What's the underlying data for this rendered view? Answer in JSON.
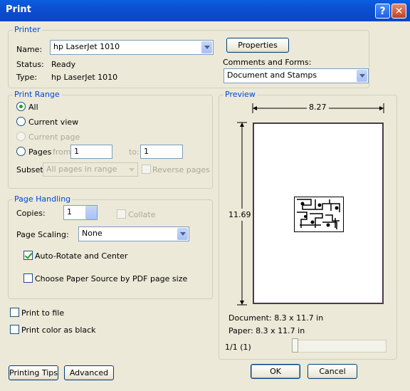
{
  "window": {
    "title": "Print",
    "help_label": "?",
    "close_label": "✕"
  },
  "printer": {
    "legend": "Printer",
    "name_label": "Name:",
    "name_value": "hp LaserJet 1010",
    "status_label": "Status:",
    "status_value": "Ready",
    "type_label": "Type:",
    "type_value": "hp LaserJet 1010",
    "properties_button": "Properties",
    "comments_label": "Comments and Forms:",
    "comments_value": "Document and Stamps"
  },
  "print_range": {
    "legend": "Print Range",
    "all": "All",
    "current_view": "Current view",
    "current_page": "Current page",
    "pages": "Pages",
    "from_label": "from:",
    "from_value": "1",
    "to_label": "to:",
    "to_value": "1",
    "subset_label": "Subset:",
    "subset_value": "All pages in range",
    "reverse_pages": "Reverse pages"
  },
  "page_handling": {
    "legend": "Page Handling",
    "copies_label": "Copies:",
    "copies_value": "1",
    "collate": "Collate",
    "scaling_label": "Page Scaling:",
    "scaling_value": "None",
    "auto_rotate": "Auto-Rotate and Center",
    "choose_paper": "Choose Paper Source by PDF page size"
  },
  "options": {
    "print_to_file": "Print to file",
    "print_color_black": "Print color as black"
  },
  "preview": {
    "legend": "Preview",
    "width": "8.27",
    "height": "11.69",
    "document_size": "Document: 8.3 x 11.7 in",
    "paper_size": "Paper: 8.3 x 11.7 in",
    "page_indicator": "1/1 (1)"
  },
  "buttons": {
    "printing_tips": "Printing Tips",
    "advanced": "Advanced",
    "ok": "OK",
    "cancel": "Cancel"
  },
  "colors": {
    "title_bar": "#0a4fd0",
    "legend_text": "#0046d5",
    "dialog_bg": "#ece9d8"
  }
}
